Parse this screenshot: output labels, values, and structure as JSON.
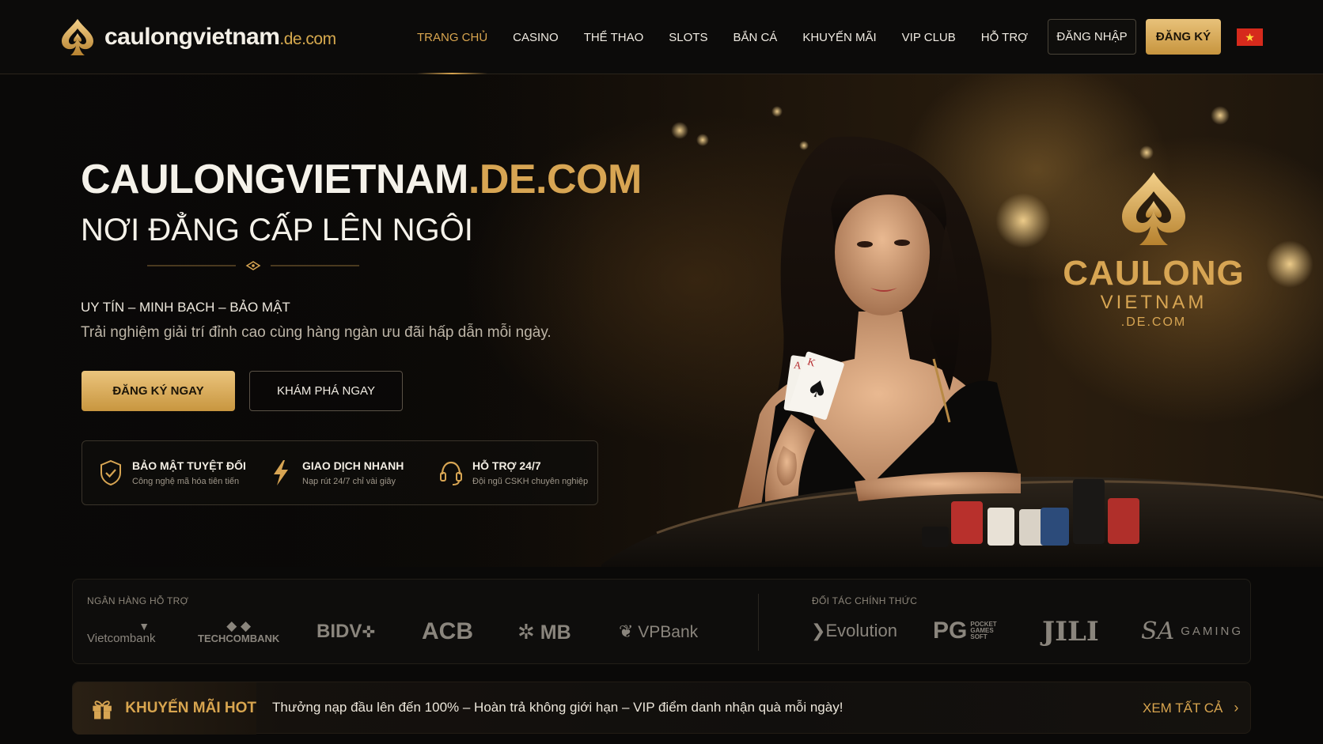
{
  "header": {
    "logo_text": "caulongvietnam",
    "logo_suffix": ".de.com",
    "menu": [
      {
        "label": "TRANG CHỦ",
        "active": true
      },
      {
        "label": "CASINO"
      },
      {
        "label": "THỂ THAO"
      },
      {
        "label": "SLOTS"
      },
      {
        "label": "BẮN CÁ"
      },
      {
        "label": "KHUYẾN MÃI"
      },
      {
        "label": "VIP CLUB"
      },
      {
        "label": "HỖ TRỢ"
      }
    ],
    "login_label": "ĐĂNG NHẬP",
    "register_label": "ĐĂNG KÝ",
    "language_icon": "vietnam-flag-icon"
  },
  "hero": {
    "title_main": "CAULONGVIETNAM",
    "title_accent": ".DE.COM",
    "subtitle": "NƠI ĐẲNG CẤP LÊN NGÔI",
    "tagline": "UY TÍN – MINH BẠCH – BẢO MẬT",
    "description": "Trải nghiệm giải trí đỉnh cao cùng hàng ngàn ưu đãi hấp dẫn mỗi ngày.",
    "cta_primary": "ĐĂNG KÝ NGAY",
    "cta_secondary": "KHÁM PHÁ NGAY",
    "features": [
      {
        "icon": "shield-check-icon",
        "title": "BẢO MẬT TUYỆT ĐỐI",
        "desc": "Công nghệ mã hóa tiên tiến"
      },
      {
        "icon": "lightning-icon",
        "title": "GIAO DỊCH NHANH",
        "desc": "Nạp rút 24/7 chỉ vài giây"
      },
      {
        "icon": "headset-icon",
        "title": "HỖ TRỢ 24/7",
        "desc": "Đội ngũ CSKH chuyên nghiệp"
      }
    ],
    "brand_name": "CAULONG",
    "brand_sub": "VIETNAM",
    "brand_domain": ".DE.COM"
  },
  "partners": {
    "banks_label": "NGÂN HÀNG HỖ TRỢ",
    "banks": [
      "Vietcombank",
      "TECHCOMBANK",
      "BIDV",
      "ACB",
      "MB",
      "VPBank"
    ],
    "providers_label": "ĐỐI TÁC CHÍNH THỨC",
    "providers": [
      "Evolution",
      "PG",
      "JILI",
      "GAMING"
    ],
    "pg_small": "POCKET GAMES SOFT",
    "sa_mark": "SA"
  },
  "promo": {
    "title": "KHUYẾN MÃI HOT",
    "text": "Thưởng nạp đầu lên đến 100% – Hoàn trả không giới hạn – VIP điểm danh nhận quà mỗi ngày!",
    "link": "XEM TẤT CẢ"
  },
  "colors": {
    "accent": "#d8a54f",
    "background": "#0a0908",
    "flag_red": "#d62a1c",
    "flag_star": "#ffdb3a"
  }
}
